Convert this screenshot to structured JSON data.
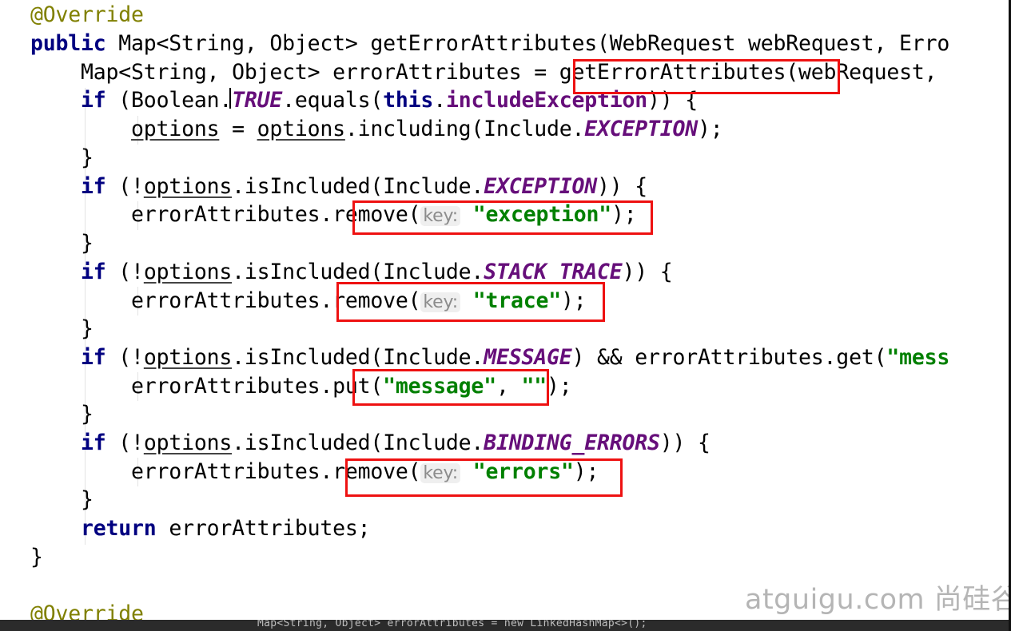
{
  "code": {
    "annotation": "@Override",
    "signature": {
      "kw": "public",
      "text": " Map<String, Object> getErrorAttributes(WebRequest webRequest, Erro"
    },
    "assign": {
      "before": "Map<String, Object> errorAttributes = ",
      "call": "getErrorAttributes",
      "after": "(webRequest,"
    },
    "if_include": {
      "kw": "if",
      "a": " (Boolean.",
      "cst": "TRUE",
      "b": ".equals(",
      "this_kw": "this",
      "dot": ".",
      "field": "includeException",
      "end": ")) {"
    },
    "options_assign": {
      "var1": "options",
      "mid": " = ",
      "var2": "options",
      "rest": ".including(Include.",
      "cst": "EXCEPTION",
      "end": ");"
    },
    "close_brace": "}",
    "if_exception": {
      "kw": "if",
      "a": " (!",
      "var": "options",
      "b": ".isIncluded(Include.",
      "cst": "EXCEPTION",
      "end": ")) {"
    },
    "remove_exception": {
      "obj": "errorAttributes.",
      "method": "remove(",
      "hint": "key:",
      "str": "\"exception\"",
      "end": ");"
    },
    "if_trace": {
      "kw": "if",
      "a": " (!",
      "var": "options",
      "b": ".isIncluded(Include.",
      "cst": "STACK_TRACE",
      "end": ")) {"
    },
    "remove_trace": {
      "obj": "errorAttributes",
      "method": ".remove(",
      "hint": "key:",
      "str": "\"trace\"",
      "end": ");"
    },
    "if_message": {
      "kw": "if",
      "a": " (!",
      "var": "options",
      "b": ".isIncluded(Include.",
      "cst": "MESSAGE",
      "c": ") && errorAttributes.get(",
      "str": "\"mess"
    },
    "put_message": {
      "obj": "errorAttributes.",
      "method": "put(",
      "str1": "\"message\"",
      "comma": ", ",
      "str2": "\"\"",
      "end": ");"
    },
    "if_binding": {
      "kw": "if",
      "a": " (!",
      "var": "options",
      "b": ".isIncluded(Include.",
      "cst": "BINDING_ERRORS",
      "end": ")) {"
    },
    "remove_errors": {
      "obj": "errorAttributes.",
      "method": "remove(",
      "hint": "key:",
      "str": "\"errors\"",
      "end": ");"
    },
    "return_stmt": {
      "kw": "return",
      "text": " errorAttributes;"
    },
    "annotation2": "@Override"
  },
  "bottom_ghost_text": "Map<String, Object> errorAttributes = new LinkedHashMap<>();",
  "watermark": "atguigu.com 尚硅谷",
  "colors": {
    "keyword": "#000080",
    "string": "#008000",
    "constant": "#660e7a",
    "annotation": "#808000",
    "highlight_box": "#ee1111"
  }
}
